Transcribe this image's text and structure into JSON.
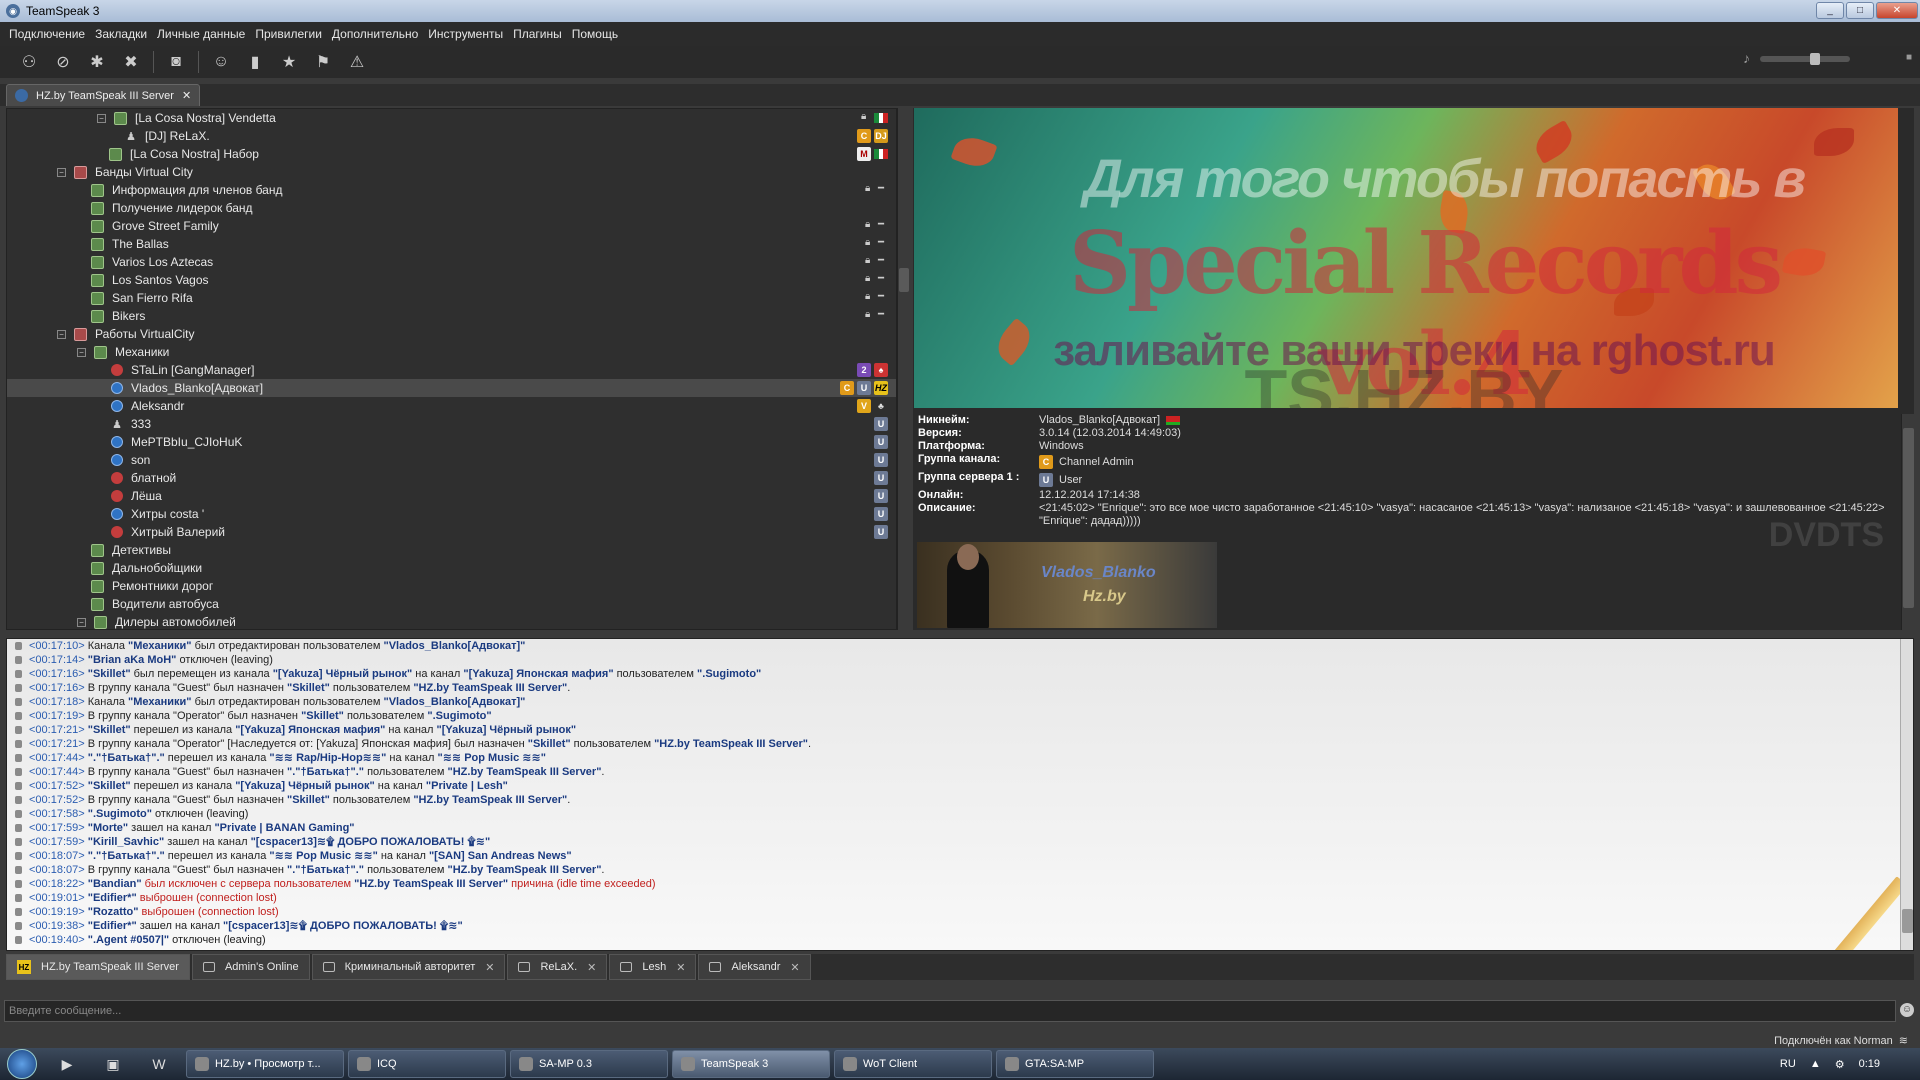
{
  "window": {
    "title": "TeamSpeak 3",
    "min": "_",
    "max": "□",
    "close": "✕"
  },
  "menu": [
    "Подключение",
    "Закладки",
    "Личные данные",
    "Привилегии",
    "Дополнительно",
    "Инструменты",
    "Плагины",
    "Помощь"
  ],
  "server_tab": {
    "label": "HZ.by TeamSpeak III Server",
    "close": "✕"
  },
  "tree": [
    {
      "indent": 90,
      "type": "exp-ch",
      "label": "[La Cosa Nostra] Vendetta",
      "right": "lock-flag-it"
    },
    {
      "indent": 118,
      "type": "user-s",
      "label": "[DJ] ReLaX.",
      "right": "c-dj"
    },
    {
      "indent": 102,
      "type": "ch",
      "label": "[La Cosa Nostra] Набор",
      "right": "m-flag"
    },
    {
      "indent": 50,
      "type": "exp-chr",
      "label": "Банды Virtual City",
      "right": ""
    },
    {
      "indent": 84,
      "type": "ch",
      "label": "Информация для членов банд",
      "right": "lock"
    },
    {
      "indent": 84,
      "type": "ch",
      "label": "Получение лидерок банд",
      "right": ""
    },
    {
      "indent": 84,
      "type": "ch",
      "label": "Grove Street Family",
      "right": "lock"
    },
    {
      "indent": 84,
      "type": "ch",
      "label": "The Ballas",
      "right": "lock"
    },
    {
      "indent": 84,
      "type": "ch",
      "label": "Varios Los Aztecas",
      "right": "lock"
    },
    {
      "indent": 84,
      "type": "ch",
      "label": "Los Santos Vagos",
      "right": "lock"
    },
    {
      "indent": 84,
      "type": "ch",
      "label": "San Fierro Rifa",
      "right": "lock"
    },
    {
      "indent": 84,
      "type": "ch",
      "label": "Bikers",
      "right": "lock"
    },
    {
      "indent": 50,
      "type": "exp-chr",
      "label": "Работы VirtualCity",
      "right": ""
    },
    {
      "indent": 70,
      "type": "exp-ch",
      "label": "Механики",
      "right": ""
    },
    {
      "indent": 104,
      "type": "user-r",
      "label": "STaLin [GangManager]",
      "right": "2"
    },
    {
      "indent": 104,
      "type": "user",
      "label": "Vlados_Blanko[Адвокат]",
      "right": "c-u-hz",
      "sel": true
    },
    {
      "indent": 104,
      "type": "user",
      "label": "Aleksandr",
      "right": "v"
    },
    {
      "indent": 104,
      "type": "user-s",
      "label": "333",
      "right": "u"
    },
    {
      "indent": 104,
      "type": "user",
      "label": "MePTBbIu_CJIoHuK",
      "right": "u"
    },
    {
      "indent": 104,
      "type": "user",
      "label": "son",
      "right": "u"
    },
    {
      "indent": 104,
      "type": "user-r",
      "label": "блатной",
      "right": "u"
    },
    {
      "indent": 104,
      "type": "user-r",
      "label": "Лёша",
      "right": "u"
    },
    {
      "indent": 104,
      "type": "user",
      "label": "Хитры costa '",
      "right": "u"
    },
    {
      "indent": 104,
      "type": "user-r",
      "label": "Хитрый Валерий",
      "right": "u"
    },
    {
      "indent": 84,
      "type": "ch",
      "label": "Детективы",
      "right": ""
    },
    {
      "indent": 84,
      "type": "ch",
      "label": "Дальнобойщики",
      "right": ""
    },
    {
      "indent": 84,
      "type": "ch",
      "label": "Ремонтники дорог",
      "right": ""
    },
    {
      "indent": 84,
      "type": "ch",
      "label": "Водители автобуса",
      "right": ""
    },
    {
      "indent": 70,
      "type": "exp-ch",
      "label": "Дилеры автомобилей",
      "right": ""
    }
  ],
  "banner": {
    "line1": "Для того чтобы попасть в",
    "line2": "Special Records vol.4",
    "line3": "заливайте ваши треки на rghost.ru",
    "line4": "TS.HZ.BY"
  },
  "info": {
    "nickname_k": "Никнейм:",
    "nickname_v": "Vlados_Blanko[Адвокат]",
    "version_k": "Версия:",
    "version_v": "3.0.14 (12.03.2014 14:49:03)",
    "platform_k": "Платформа:",
    "platform_v": "Windows",
    "chgroup_k": "Группа канала:",
    "chgroup_v": "Channel Admin",
    "srvgroup_k": "Группа сервера 1 :",
    "srvgroup_v": "User",
    "online_k": "Онлайн:",
    "online_v": "12.12.2014 17:14:38",
    "desc_k": "Описание:",
    "desc_v": "<21:45:02> \"Enrique\": это все мое чисто заработанное <21:45:10> \"vasya\": насасаное <21:45:13> \"vasya\": нализаное <21:45:18> \"vasya\": и зашлевованное <21:45:22> \"Enrique\": дадад)))))",
    "avatar_line1": "Vlados_Blanko",
    "avatar_line2": "Hz.by",
    "watermark": "DVDTS"
  },
  "chat": [
    {
      "ts": "<00:17:10>",
      "parts": [
        [
          "t",
          "Канала "
        ],
        [
          "b",
          "\"Механики\""
        ],
        [
          "t",
          " был отредактирован пользователем "
        ],
        [
          "b",
          "\"Vlados_Blanko[Адвокат]\""
        ]
      ]
    },
    {
      "ts": "<00:17:14>",
      "parts": [
        [
          "b",
          "\"Brian aKa MoH\""
        ],
        [
          "t",
          " отключен (leaving)"
        ]
      ]
    },
    {
      "ts": "<00:17:16>",
      "parts": [
        [
          "b",
          "\"Skillet\""
        ],
        [
          "t",
          " был перемещен из канала "
        ],
        [
          "b",
          "\"[Yakuza] Чёрный рынок\""
        ],
        [
          "t",
          " на канал "
        ],
        [
          "b",
          "\"[Yakuza] Японская мафия\""
        ],
        [
          "t",
          " пользователем "
        ],
        [
          "b",
          "\".Sugimoto\""
        ]
      ]
    },
    {
      "ts": "<00:17:16>",
      "parts": [
        [
          "t",
          "В группу канала \"Guest\" был назначен "
        ],
        [
          "b",
          "\"Skillet\""
        ],
        [
          "t",
          " пользователем "
        ],
        [
          "b",
          "\"HZ.by TeamSpeak III Server\""
        ],
        [
          "t",
          "."
        ]
      ]
    },
    {
      "ts": "<00:17:18>",
      "parts": [
        [
          "t",
          "Канала "
        ],
        [
          "b",
          "\"Механики\""
        ],
        [
          "t",
          " был отредактирован пользователем "
        ],
        [
          "b",
          "\"Vlados_Blanko[Адвокат]\""
        ]
      ]
    },
    {
      "ts": "<00:17:19>",
      "parts": [
        [
          "t",
          "В группу канала \"Operator\" был назначен "
        ],
        [
          "b",
          "\"Skillet\""
        ],
        [
          "t",
          " пользователем "
        ],
        [
          "b",
          "\".Sugimoto\""
        ]
      ]
    },
    {
      "ts": "<00:17:21>",
      "parts": [
        [
          "b",
          "\"Skillet\""
        ],
        [
          "t",
          " перешел из канала "
        ],
        [
          "b",
          "\"[Yakuza] Японская мафия\""
        ],
        [
          "t",
          " на канал "
        ],
        [
          "b",
          "\"[Yakuza] Чёрный рынок\""
        ]
      ]
    },
    {
      "ts": "<00:17:21>",
      "parts": [
        [
          "t",
          "В группу канала \"Operator\" [Наследуется от: [Yakuza] Японская мафия] был назначен "
        ],
        [
          "b",
          "\"Skillet\""
        ],
        [
          "t",
          " пользователем "
        ],
        [
          "b",
          "\"HZ.by TeamSpeak III Server\""
        ],
        [
          "t",
          "."
        ]
      ]
    },
    {
      "ts": "<00:17:44>",
      "parts": [
        [
          "b",
          "\".\"†Батька†\".\""
        ],
        [
          "t",
          " перешел из канала "
        ],
        [
          "b",
          "\"≋≋ Rap/Hip-Hop≋≋\""
        ],
        [
          "t",
          " на канал "
        ],
        [
          "b",
          "\"≋≋ Pop Music ≋≋\""
        ]
      ]
    },
    {
      "ts": "<00:17:44>",
      "parts": [
        [
          "t",
          "В группу канала \"Guest\" был назначен "
        ],
        [
          "b",
          "\".\"†Батька†\".\""
        ],
        [
          "t",
          " пользователем "
        ],
        [
          "b",
          "\"HZ.by TeamSpeak III Server\""
        ],
        [
          "t",
          "."
        ]
      ]
    },
    {
      "ts": "<00:17:52>",
      "parts": [
        [
          "b",
          "\"Skillet\""
        ],
        [
          "t",
          " перешел из канала "
        ],
        [
          "b",
          "\"[Yakuza] Чёрный рынок\""
        ],
        [
          "t",
          " на канал "
        ],
        [
          "b",
          "\"Private | Lesh\""
        ]
      ]
    },
    {
      "ts": "<00:17:52>",
      "parts": [
        [
          "t",
          "В группу канала \"Guest\" был назначен "
        ],
        [
          "b",
          "\"Skillet\""
        ],
        [
          "t",
          " пользователем "
        ],
        [
          "b",
          "\"HZ.by TeamSpeak III Server\""
        ],
        [
          "t",
          "."
        ]
      ]
    },
    {
      "ts": "<00:17:58>",
      "parts": [
        [
          "b",
          "\".Sugimoto\""
        ],
        [
          "t",
          " отключен (leaving)"
        ]
      ]
    },
    {
      "ts": "<00:17:59>",
      "parts": [
        [
          "b",
          "\"Morte\""
        ],
        [
          "t",
          " зашел на канал "
        ],
        [
          "b",
          "\"Private | BANAN Gaming\""
        ]
      ]
    },
    {
      "ts": "<00:17:59>",
      "parts": [
        [
          "b",
          "\"Kirill_Savhic\""
        ],
        [
          "t",
          " зашел на канал "
        ],
        [
          "b",
          "\"[cspacer13]≋۩ ДОБРО ПОЖАЛОВАТЬ! ۩≋\""
        ]
      ]
    },
    {
      "ts": "<00:18:07>",
      "parts": [
        [
          "b",
          "\".\"†Батька†\".\""
        ],
        [
          "t",
          " перешел из канала "
        ],
        [
          "b",
          "\"≋≋ Pop Music ≋≋\""
        ],
        [
          "t",
          " на канал "
        ],
        [
          "b",
          "\"[SAN] San Andreas News\""
        ]
      ]
    },
    {
      "ts": "<00:18:07>",
      "parts": [
        [
          "t",
          "В группу канала \"Guest\" был назначен "
        ],
        [
          "b",
          "\".\"†Батька†\".\""
        ],
        [
          "t",
          " пользователем "
        ],
        [
          "b",
          "\"HZ.by TeamSpeak III Server\""
        ],
        [
          "t",
          "."
        ]
      ]
    },
    {
      "ts": "<00:18:22>",
      "parts": [
        [
          "b",
          "\"Bandian\""
        ],
        [
          "r",
          " был исключен с сервера пользователем "
        ],
        [
          "b",
          "\"HZ.by TeamSpeak III Server\""
        ],
        [
          "r",
          " причина (idle time exceeded)"
        ]
      ]
    },
    {
      "ts": "<00:19:01>",
      "parts": [
        [
          "b",
          "\"Edifier*\""
        ],
        [
          "r",
          " выброшен (connection lost)"
        ]
      ]
    },
    {
      "ts": "<00:19:19>",
      "parts": [
        [
          "b",
          "\"Rozatto\""
        ],
        [
          "r",
          " выброшен (connection lost)"
        ]
      ]
    },
    {
      "ts": "<00:19:38>",
      "parts": [
        [
          "b",
          "\"Edifier*\""
        ],
        [
          "t",
          " зашел на канал "
        ],
        [
          "b",
          "\"[cspacer13]≋۩ ДОБРО ПОЖАЛОВАТЬ! ۩≋\""
        ]
      ]
    },
    {
      "ts": "<00:19:40>",
      "parts": [
        [
          "b",
          "\".Agent #0507|\""
        ],
        [
          "t",
          " отключен (leaving)"
        ]
      ]
    }
  ],
  "chat_tabs": [
    {
      "label": "HZ.by TeamSpeak III Server",
      "icon": "hz",
      "active": true,
      "close": false
    },
    {
      "label": "Admin's Online",
      "icon": "chat",
      "active": false,
      "close": false
    },
    {
      "label": "Криминальный авторитет",
      "icon": "chat",
      "active": false,
      "close": true
    },
    {
      "label": "ReLaX.",
      "icon": "chat",
      "active": false,
      "close": true
    },
    {
      "label": "Lesh",
      "icon": "chat",
      "active": false,
      "close": true
    },
    {
      "label": "Aleksandr",
      "icon": "chat",
      "active": false,
      "close": true
    }
  ],
  "input_placeholder": "Введите сообщение...",
  "status_text": "Подключён как Norman",
  "taskbar": [
    {
      "label": "HZ.by • Просмотр т...",
      "active": false
    },
    {
      "label": "ICQ",
      "active": false
    },
    {
      "label": "SA-MP 0.3",
      "active": false
    },
    {
      "label": "TeamSpeak 3",
      "active": true
    },
    {
      "label": "WoT Client",
      "active": false
    },
    {
      "label": "GTA:SA:MP",
      "active": false
    }
  ],
  "tray": {
    "lang": "RU",
    "time": "0:19"
  },
  "colors": {
    "accent": "#2f73c4",
    "badge_c": "#e09a1a",
    "hz": "#e8c21a",
    "kick": "#c0201e"
  }
}
